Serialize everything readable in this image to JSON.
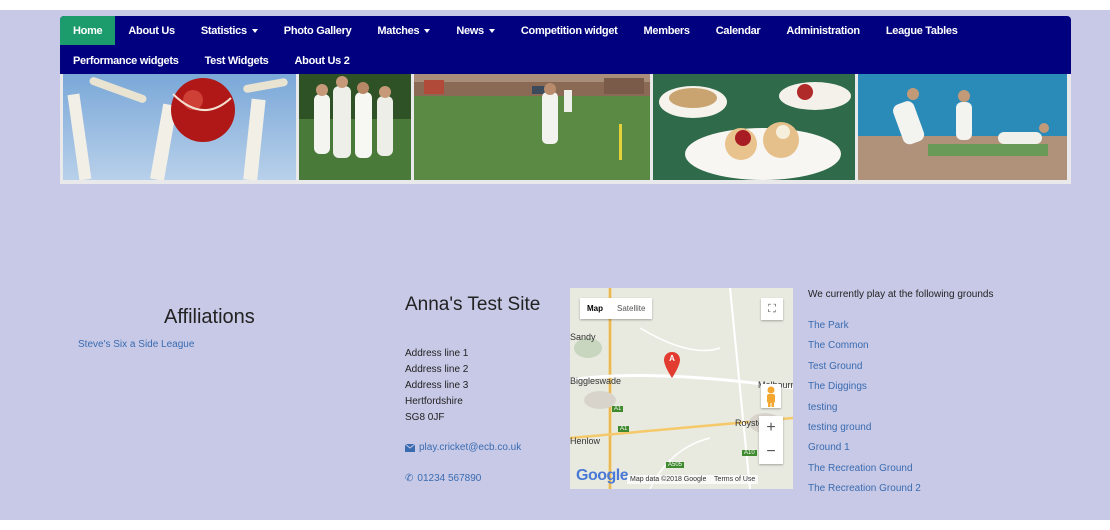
{
  "nav": {
    "row1": [
      {
        "label": "Home",
        "dropdown": false,
        "active": true
      },
      {
        "label": "About Us",
        "dropdown": false
      },
      {
        "label": "Statistics",
        "dropdown": true
      },
      {
        "label": "Photo Gallery",
        "dropdown": false
      },
      {
        "label": "Matches",
        "dropdown": true
      },
      {
        "label": "News",
        "dropdown": true
      },
      {
        "label": "Competition widget",
        "dropdown": false
      },
      {
        "label": "Members",
        "dropdown": false
      },
      {
        "label": "Calendar",
        "dropdown": false
      },
      {
        "label": "Administration",
        "dropdown": false
      },
      {
        "label": "League Tables",
        "dropdown": false
      }
    ],
    "row2": [
      {
        "label": "Performance widgets",
        "dropdown": false
      },
      {
        "label": "Test Widgets",
        "dropdown": false
      },
      {
        "label": "About Us 2",
        "dropdown": false
      }
    ]
  },
  "affiliations": {
    "title": "Affiliations",
    "link": "Steve's Six a Side League"
  },
  "site": {
    "name": "Anna's Test Site",
    "address": [
      "Address line 1",
      "Address line 2",
      "Address line 3",
      "Hertfordshire",
      "SG8 0JF"
    ],
    "email": "play.cricket@ecb.co.uk",
    "phone": "01234 567890"
  },
  "map": {
    "type_map": "Map",
    "type_satellite": "Satellite",
    "marker": "A",
    "places": [
      "Sandy",
      "Biggleswade",
      "Royston",
      "Henlow",
      "Melbourn"
    ],
    "roads": [
      "A1",
      "A1",
      "A505",
      "A10"
    ],
    "zoom_in": "+",
    "zoom_out": "−",
    "logo": "Google",
    "attribution": "Map data ©2018 Google",
    "terms": "Terms of Use"
  },
  "grounds": {
    "intro": "We currently play at the following grounds",
    "items": [
      "The Park",
      "The Common",
      "Test Ground",
      "The Diggings",
      "testing",
      "testing ground",
      "Ground 1",
      "The Recreation Ground",
      "The Recreation Ground 2"
    ]
  },
  "colors": {
    "navbar": "#01007f",
    "active_tab": "#1c9b6d",
    "page_bg": "#c7c9e6",
    "link": "#3a6bb0"
  }
}
